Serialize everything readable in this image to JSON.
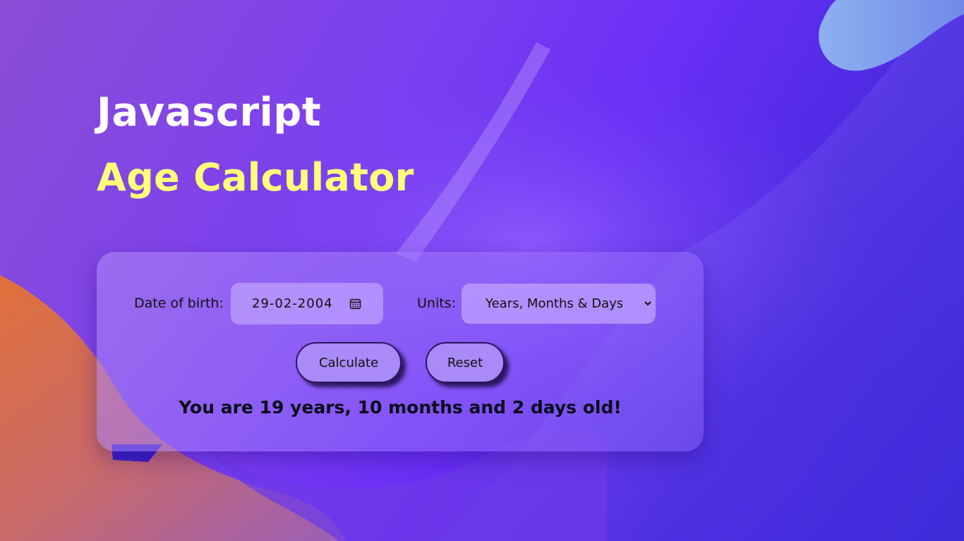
{
  "header": {
    "line1": "Javascript",
    "line2": "Age Calculator"
  },
  "form": {
    "dob_label": "Date of birth:",
    "dob_value": "29-02-2004",
    "units_label": "Units:",
    "units_selected": "Years, Months & Days",
    "units_options": [
      "Years, Months & Days"
    ]
  },
  "buttons": {
    "calculate": "Calculate",
    "reset": "Reset"
  },
  "result": {
    "text": "You are 19 years, 10 months and 2 days old!"
  },
  "icons": {
    "calendar": "calendar-icon",
    "chevron": "chevron-down-icon"
  },
  "colors": {
    "title_primary": "#ffffff",
    "title_accent": "#ffff7a",
    "background_start": "#8a4ed6",
    "background_end": "#3d2bd8",
    "button_fill": "#a98af7"
  }
}
